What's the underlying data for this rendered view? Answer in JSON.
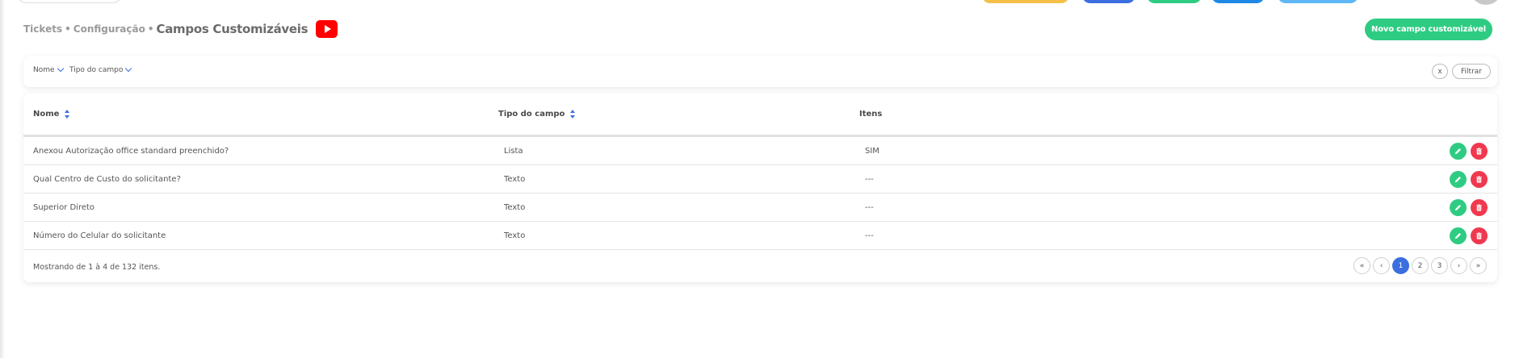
{
  "breadcrumb": {
    "items": [
      "Tickets",
      "Configuração"
    ],
    "separator": "•",
    "current": "Campos Customizáveis"
  },
  "header": {
    "new_button_label": "Novo campo customizável"
  },
  "top_buttons_colors": [
    "#f5c04a",
    "#3b6fe0",
    "#2ecc82",
    "#1e88e5",
    "#5fb8f5"
  ],
  "filters": {
    "nome_label": "Nome",
    "tipo_label": "Tipo do campo",
    "clear_label": "x",
    "filter_label": "Filtrar"
  },
  "table": {
    "columns": [
      "Nome",
      "Tipo do campo",
      "Itens"
    ],
    "rows": [
      {
        "nome": "Anexou Autorização office standard preenchido?",
        "tipo": "Lista",
        "itens": "SIM"
      },
      {
        "nome": "Qual Centro de Custo do solicitante?",
        "tipo": "Texto",
        "itens": "---"
      },
      {
        "nome": "Superior Direto",
        "tipo": "Texto",
        "itens": "---"
      },
      {
        "nome": "Número do Celular do solicitante",
        "tipo": "Texto",
        "itens": "---"
      }
    ]
  },
  "pagination": {
    "summary": "Mostrando de 1 à 4 de 132 itens.",
    "first": "«",
    "prev": "‹",
    "pages": [
      "1",
      "2",
      "3"
    ],
    "current_page": "1",
    "next": "›",
    "last": "»"
  },
  "colors": {
    "accent_green": "#2ecc82",
    "accent_blue": "#3b6fe0",
    "danger_red": "#f0384e",
    "youtube_red": "#ff0000"
  }
}
